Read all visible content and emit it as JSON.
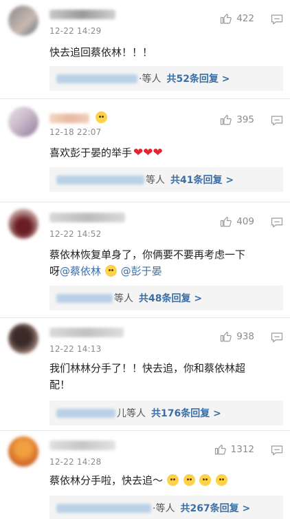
{
  "comments": [
    {
      "time": "12-22 14:29",
      "likes": "422",
      "text": "快去追回蔡依林！！！",
      "reply_suffix": "·等人",
      "reply_total": "共52条回复 >"
    },
    {
      "time": "12-18 22:07",
      "likes": "395",
      "text": "喜欢彭于晏的举手",
      "hearts": "❤❤❤",
      "reply_suffix": "等人",
      "reply_total": "共41条回复 >"
    },
    {
      "time": "12-22 14:52",
      "likes": "409",
      "text": "蔡依林恢复单身了，你俩要不要再考虑一下",
      "text2_prefix": "呀",
      "mention1": "@蔡依林",
      "mention2": "@彭于晏",
      "reply_suffix": "等人",
      "reply_total": "共48条回复 >"
    },
    {
      "time": "12-22 14:13",
      "likes": "938",
      "text": "我们林林分手了！！快去追，你和蔡依林超",
      "text2": "配！",
      "reply_suffix": "儿等人",
      "reply_total": "共176条回复 >"
    },
    {
      "time": "12-22 14:28",
      "likes": "1312",
      "text": "蔡依林分手啦，快去追～",
      "reply_suffix": "·等人",
      "reply_total": "共267条回复 >"
    }
  ],
  "icons": {
    "like": "thumbs-up-icon",
    "reply": "comment-icon",
    "emoji": "scared-face-emoji-icon"
  },
  "colors": {
    "link": "#3a6ea5",
    "meta": "#8a8a8a",
    "heart": "#e0262e",
    "reply_bg": "#f4f4f4"
  }
}
